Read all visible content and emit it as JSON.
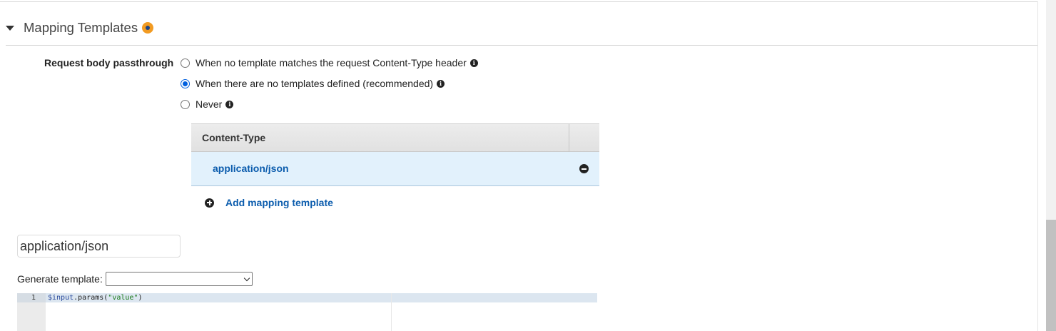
{
  "section": {
    "title": "Mapping Templates",
    "status_color": "#f29b22"
  },
  "passthrough": {
    "label": "Request body passthrough",
    "options": [
      {
        "label": "When no template matches the request Content-Type header",
        "selected": false
      },
      {
        "label": "When there are no templates defined (recommended)",
        "selected": true
      },
      {
        "label": "Never",
        "selected": false
      }
    ]
  },
  "content_type_table": {
    "header": "Content-Type",
    "rows": [
      {
        "label": "application/json"
      }
    ],
    "add_label": "Add mapping template"
  },
  "template_name_input": {
    "value": "application/json"
  },
  "generate_template": {
    "label": "Generate template:",
    "selected": ""
  },
  "editor": {
    "lines": [
      {
        "number": "1",
        "var": "$input",
        "method": ".params(",
        "string": "\"value\"",
        "close": ")"
      }
    ]
  },
  "colors": {
    "link": "#0b5cad",
    "selected_row_bg": "#e2f1fc",
    "radio_checked": "#0060df"
  },
  "icons": [
    "caret-down-icon",
    "status-dot-icon",
    "info-icon",
    "remove-icon",
    "add-icon",
    "select-chevron-icon"
  ]
}
